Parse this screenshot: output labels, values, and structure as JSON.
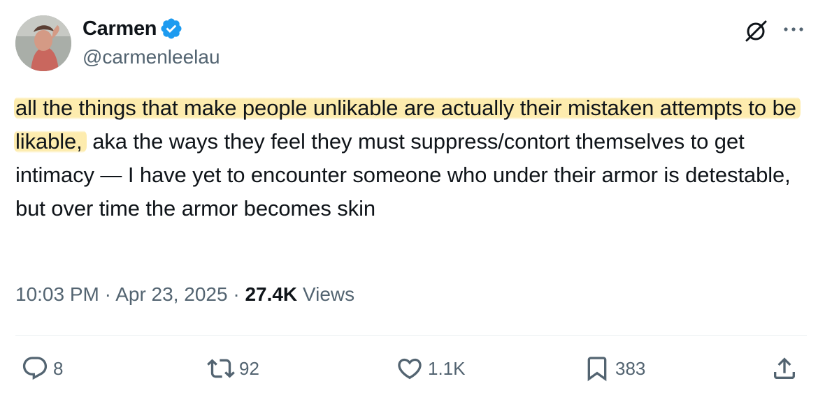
{
  "author": {
    "display_name": "Carmen",
    "handle": "@carmenleelau",
    "verified": true,
    "verified_color": "#1d9bf0"
  },
  "tweet": {
    "highlighted_text": "all the things that make people unlikable are actually their mistaken attempts to be likable,",
    "rest_text": " aka the ways they feel they must suppress/contort themselves to get intimacy — I have yet to encounter someone who under their armor is detestable, but over time the armor becomes skin",
    "highlight_color": "#fde8a0"
  },
  "meta": {
    "time": "10:03 PM",
    "sep1": " · ",
    "date": "Apr 23, 2025",
    "sep2": " · ",
    "views_count": "27.4K",
    "views_label": " Views"
  },
  "actions": {
    "replies": "8",
    "reposts": "92",
    "likes": "1.1K",
    "bookmarks": "383"
  },
  "icons": {
    "grok": "grok-icon",
    "more": "more-icon",
    "reply": "reply-icon",
    "repost": "repost-icon",
    "like": "heart-icon",
    "bookmark": "bookmark-icon",
    "share": "share-icon"
  },
  "colors": {
    "text": "#0f1419",
    "secondary": "#536471",
    "divider": "#eff3f4"
  }
}
